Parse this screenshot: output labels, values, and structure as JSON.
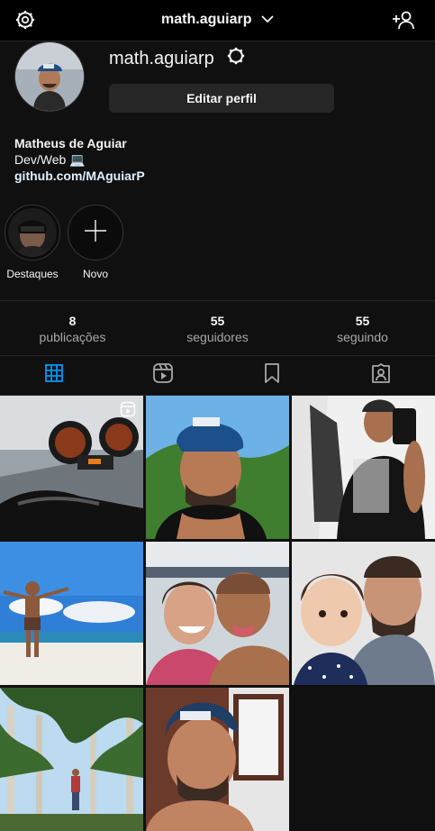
{
  "header": {
    "username_dropdown": "math.aguiarp",
    "icons": [
      "gear-icon",
      "chevron-down-icon",
      "add-user-icon"
    ]
  },
  "profile": {
    "username": "math.aguiarp",
    "edit_button": "Editar perfil",
    "full_name": "Matheus de Aguiar",
    "bio": "Dev/Web 💻",
    "link": "github.com/MAguiarP"
  },
  "highlights": [
    {
      "label": "Destaques"
    },
    {
      "label": "Novo"
    }
  ],
  "stats": [
    {
      "value": "8",
      "label": "publicações"
    },
    {
      "value": "55",
      "label": "seguidores"
    },
    {
      "value": "55",
      "label": "seguindo"
    }
  ],
  "tabs": [
    "grid-icon",
    "reels-icon",
    "saved-icon",
    "tagged-icon"
  ],
  "colors": {
    "background": "#101010",
    "active_tab": "#0095f6",
    "button": "#262626"
  },
  "posts": [
    {
      "subject": "motorcycle-dashboard",
      "is_reel": true
    },
    {
      "subject": "selfie-cap-outdoor"
    },
    {
      "subject": "mirror-selfie"
    },
    {
      "subject": "man-on-beach"
    },
    {
      "subject": "couple-selfie-beach"
    },
    {
      "subject": "selfie-with-baby"
    },
    {
      "subject": "palm-tree-path"
    },
    {
      "subject": "selfie-cap-window"
    }
  ]
}
